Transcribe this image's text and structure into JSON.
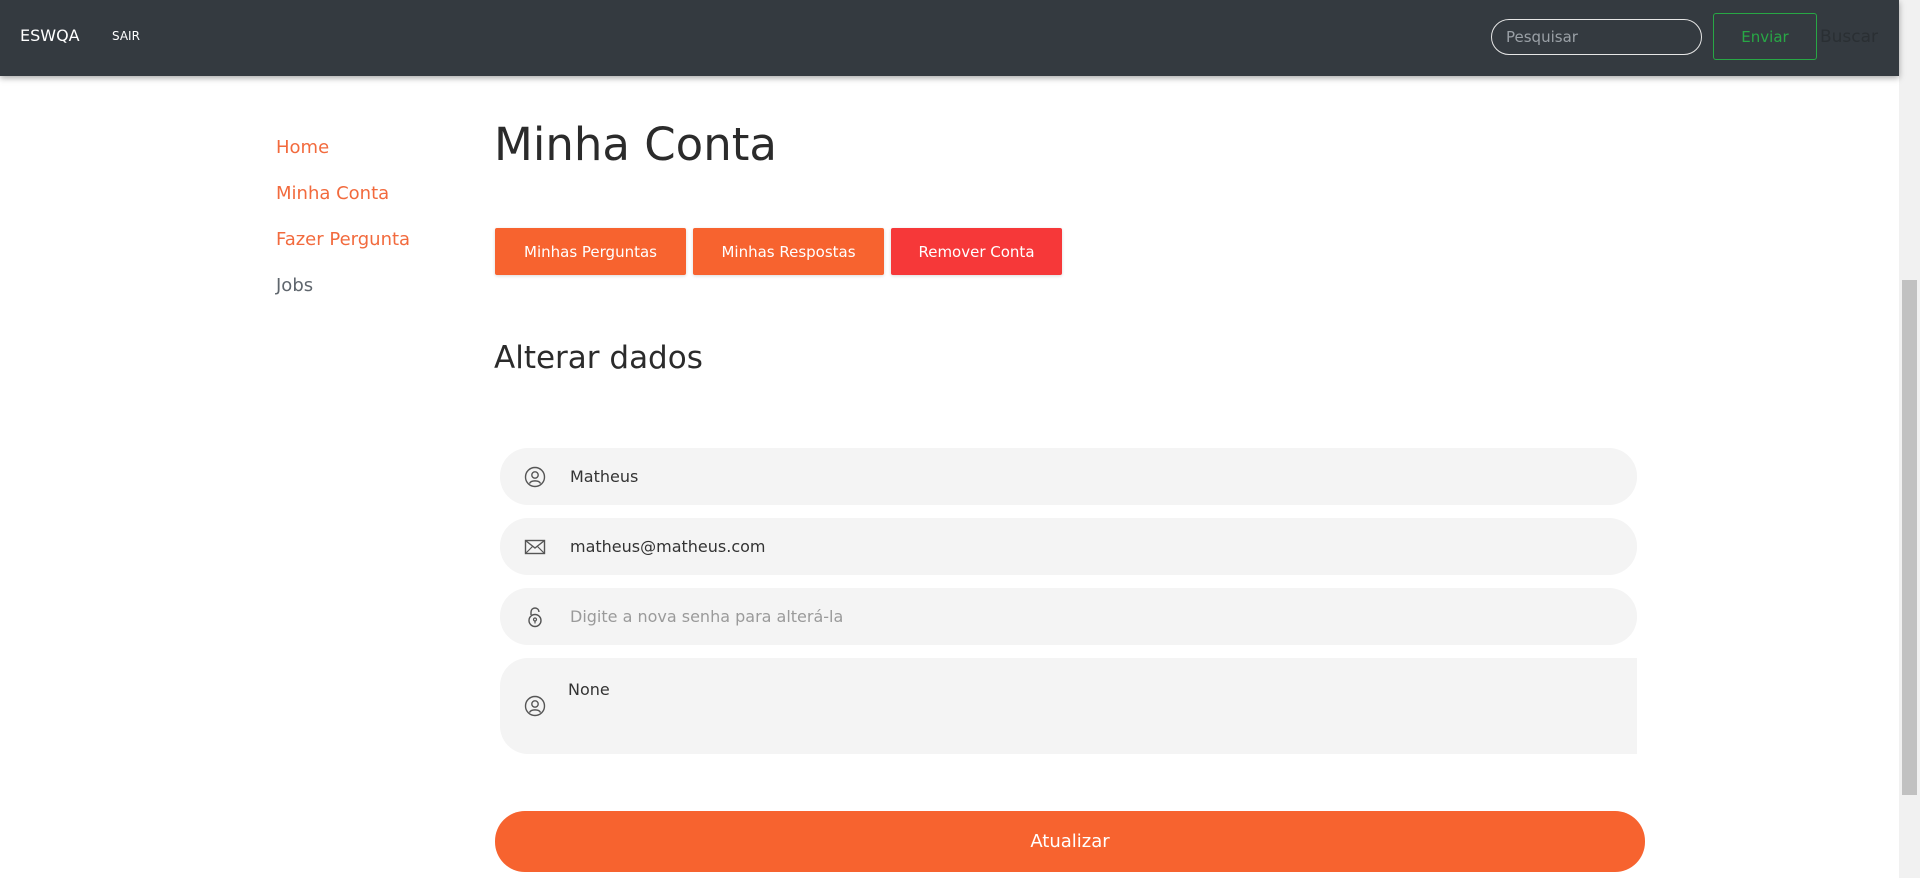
{
  "navbar": {
    "brand": "ESWQA",
    "logout_label": "SAIR",
    "search_placeholder": "Pesquisar",
    "submit_label": "Enviar",
    "search_label": "Buscar"
  },
  "sidebar": {
    "items": [
      {
        "label": "Home"
      },
      {
        "label": "Minha Conta"
      },
      {
        "label": "Fazer Pergunta"
      },
      {
        "label": "Jobs"
      }
    ]
  },
  "main": {
    "title": "Minha Conta",
    "buttons": {
      "questions": "Minhas Perguntas",
      "answers": "Minhas Respostas",
      "remove": "Remover Conta"
    },
    "section_title": "Alterar dados",
    "form": {
      "name_value": "Matheus",
      "email_value": "matheus@matheus.com",
      "password_placeholder": "Digite a nova senha para alterá-la",
      "bio_value": "None",
      "submit_label": "Atualizar"
    }
  },
  "icons": {
    "name_field": "user-icon",
    "email_field": "envelope-icon",
    "password_field": "lock-icon",
    "bio_field": "user-icon"
  },
  "colors": {
    "navbar_bg": "#343a40",
    "accent_orange": "#f7632f",
    "danger_red": "#f63839",
    "success_green": "#28a745",
    "link_orange": "#f26a3d",
    "field_bg": "#f4f4f4"
  }
}
